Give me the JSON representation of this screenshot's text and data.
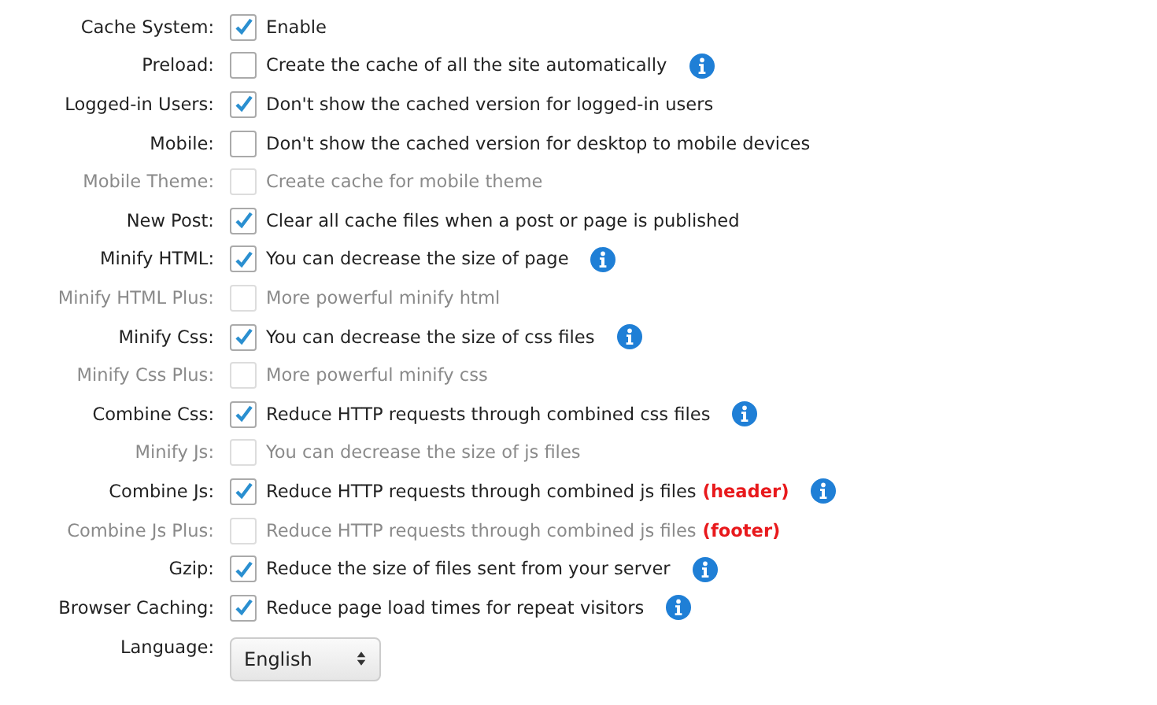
{
  "settings": [
    {
      "label": "Cache System:",
      "checked": true,
      "disabled": false,
      "text": "Enable",
      "info": false
    },
    {
      "label": "Preload:",
      "checked": false,
      "disabled": false,
      "text": "Create the cache of all the site automatically",
      "info": true
    },
    {
      "label": "Logged-in Users:",
      "checked": true,
      "disabled": false,
      "text": "Don't show the cached version for logged-in users",
      "info": false
    },
    {
      "label": "Mobile:",
      "checked": false,
      "disabled": false,
      "text": "Don't show the cached version for desktop to mobile devices",
      "info": false
    },
    {
      "label": "Mobile Theme:",
      "checked": false,
      "disabled": true,
      "text": "Create cache for mobile theme",
      "info": false
    },
    {
      "label": "New Post:",
      "checked": true,
      "disabled": false,
      "text": "Clear all cache files when a post or page is published",
      "info": false
    },
    {
      "label": "Minify HTML:",
      "checked": true,
      "disabled": false,
      "text": "You can decrease the size of page",
      "info": true
    },
    {
      "label": "Minify HTML Plus:",
      "checked": false,
      "disabled": true,
      "text": "More powerful minify html",
      "info": false
    },
    {
      "label": "Minify Css:",
      "checked": true,
      "disabled": false,
      "text": "You can decrease the size of css files",
      "info": true
    },
    {
      "label": "Minify Css Plus:",
      "checked": false,
      "disabled": true,
      "text": "More powerful minify css",
      "info": false
    },
    {
      "label": "Combine Css:",
      "checked": true,
      "disabled": false,
      "text": "Reduce HTTP requests through combined css files",
      "info": true
    },
    {
      "label": "Minify Js:",
      "checked": false,
      "disabled": true,
      "text": "You can decrease the size of js files",
      "info": false
    },
    {
      "label": "Combine Js:",
      "checked": true,
      "disabled": false,
      "text": "Reduce HTTP requests through combined js files",
      "note": "(header)",
      "info": true
    },
    {
      "label": "Combine Js Plus:",
      "checked": false,
      "disabled": true,
      "text": "Reduce HTTP requests through combined js files",
      "note": "(footer)",
      "info": false
    },
    {
      "label": "Gzip:",
      "checked": true,
      "disabled": false,
      "text": "Reduce the size of files sent from your server",
      "info": true
    },
    {
      "label": "Browser Caching:",
      "checked": true,
      "disabled": false,
      "text": "Reduce page load times for repeat visitors",
      "info": true
    }
  ],
  "language": {
    "label": "Language:",
    "value": "English"
  }
}
